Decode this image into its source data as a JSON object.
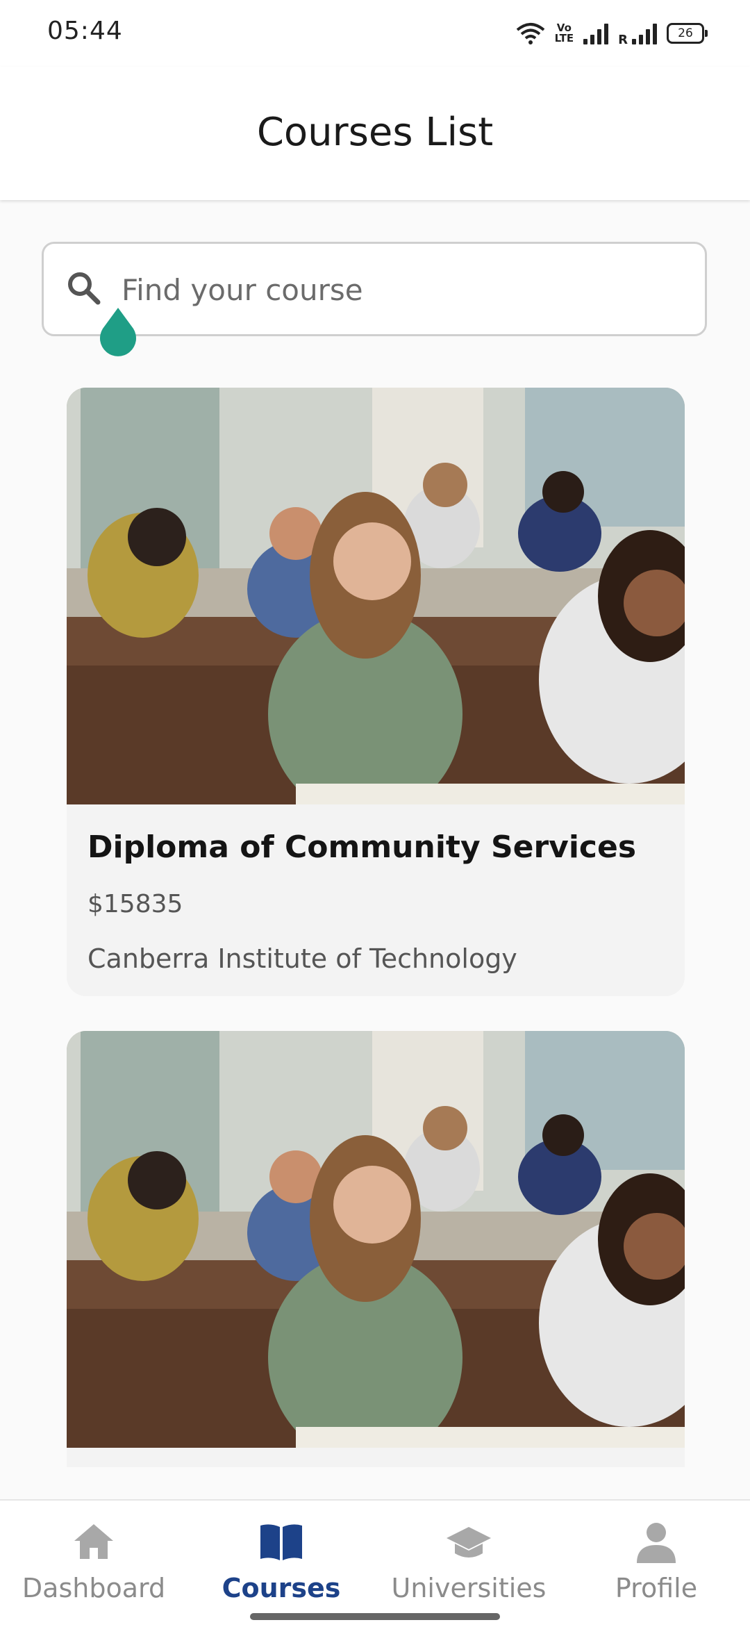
{
  "status_bar": {
    "time": "05:44",
    "volte_line1": "Vo",
    "volte_line2": "LTE",
    "roaming": "R",
    "battery": "26"
  },
  "header": {
    "title": "Courses List"
  },
  "search": {
    "placeholder": "Find your course",
    "value": ""
  },
  "courses": [
    {
      "title": "Diploma of Community Services",
      "price": "$15835",
      "institution": "Canberra Institute of Technology",
      "image": "classroom-students-photo"
    },
    {
      "title": "",
      "price": "",
      "institution": "",
      "image": "classroom-students-photo"
    }
  ],
  "bottom_nav": {
    "items": [
      {
        "label": "Dashboard",
        "icon": "home-icon",
        "active": false
      },
      {
        "label": "Courses",
        "icon": "book-icon",
        "active": true
      },
      {
        "label": "Universities",
        "icon": "graduation-cap-icon",
        "active": false
      },
      {
        "label": "Profile",
        "icon": "person-icon",
        "active": false
      }
    ]
  },
  "colors": {
    "accent": "#1d4289",
    "inactive": "#8b8b8b",
    "cursor": "#1f9e86"
  }
}
